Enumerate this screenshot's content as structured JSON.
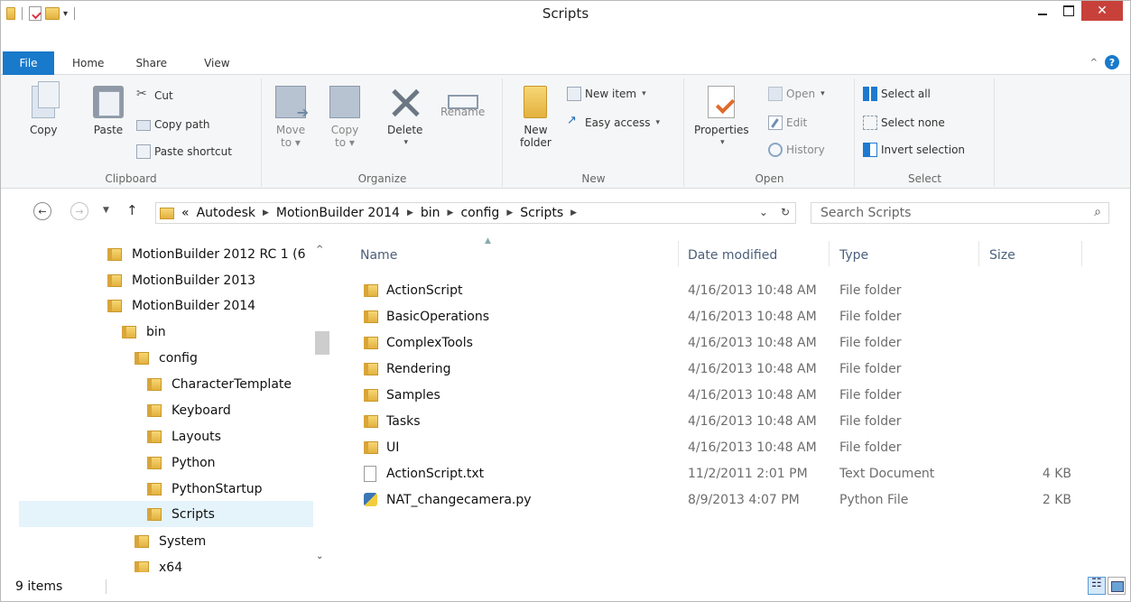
{
  "window": {
    "title": "Scripts",
    "close_symbol": "✕"
  },
  "ribbon_tabs": [
    "File",
    "Home",
    "Share",
    "View"
  ],
  "ribbon": {
    "clipboard": {
      "label": "Clipboard",
      "copy": "Copy",
      "paste": "Paste",
      "cut": "Cut",
      "copy_path": "Copy path",
      "paste_shortcut": "Paste shortcut"
    },
    "organize": {
      "label": "Organize",
      "move_to": "Move\nto ▾",
      "copy_to": "Copy\nto ▾",
      "delete": "Delete",
      "rename": "Rename"
    },
    "new": {
      "label": "New",
      "new_folder": "New\nfolder",
      "new_item": "New item",
      "easy_access": "Easy access"
    },
    "open": {
      "label": "Open",
      "properties": "Properties",
      "open": "Open",
      "edit": "Edit",
      "history": "History"
    },
    "select": {
      "label": "Select",
      "select_all": "Select all",
      "select_none": "Select none",
      "invert_selection": "Invert selection"
    }
  },
  "address": {
    "overflow": "«",
    "crumbs": [
      "Autodesk",
      "MotionBuilder 2014",
      "bin",
      "config",
      "Scripts"
    ]
  },
  "search": {
    "placeholder": "Search Scripts"
  },
  "tree": [
    {
      "label": "MotionBuilder 2012 RC 1 (6",
      "indent": 0
    },
    {
      "label": "MotionBuilder 2013",
      "indent": 0
    },
    {
      "label": "MotionBuilder 2014",
      "indent": 0
    },
    {
      "label": "bin",
      "indent": 1
    },
    {
      "label": "config",
      "indent": 2
    },
    {
      "label": "CharacterTemplate",
      "indent": 3
    },
    {
      "label": "Keyboard",
      "indent": 3
    },
    {
      "label": "Layouts",
      "indent": 3
    },
    {
      "label": "Python",
      "indent": 3
    },
    {
      "label": "PythonStartup",
      "indent": 3
    },
    {
      "label": "Scripts",
      "indent": 3,
      "selected": true
    },
    {
      "label": "System",
      "indent": 2
    },
    {
      "label": "x64",
      "indent": 2
    }
  ],
  "columns": [
    "Name",
    "Date modified",
    "Type",
    "Size"
  ],
  "files": [
    {
      "name": "ActionScript",
      "date": "4/16/2013 10:48 AM",
      "type": "File folder",
      "size": "",
      "icon": "folder"
    },
    {
      "name": "BasicOperations",
      "date": "4/16/2013 10:48 AM",
      "type": "File folder",
      "size": "",
      "icon": "folder"
    },
    {
      "name": "ComplexTools",
      "date": "4/16/2013 10:48 AM",
      "type": "File folder",
      "size": "",
      "icon": "folder"
    },
    {
      "name": "Rendering",
      "date": "4/16/2013 10:48 AM",
      "type": "File folder",
      "size": "",
      "icon": "folder"
    },
    {
      "name": "Samples",
      "date": "4/16/2013 10:48 AM",
      "type": "File folder",
      "size": "",
      "icon": "folder"
    },
    {
      "name": "Tasks",
      "date": "4/16/2013 10:48 AM",
      "type": "File folder",
      "size": "",
      "icon": "folder"
    },
    {
      "name": "UI",
      "date": "4/16/2013 10:48 AM",
      "type": "File folder",
      "size": "",
      "icon": "folder"
    },
    {
      "name": "ActionScript.txt",
      "date": "11/2/2011 2:01 PM",
      "type": "Text Document",
      "size": "4 KB",
      "icon": "text"
    },
    {
      "name": "NAT_changecamera.py",
      "date": "8/9/2013 4:07 PM",
      "type": "Python File",
      "size": "2 KB",
      "icon": "python"
    }
  ],
  "status": {
    "count": "9 items"
  }
}
